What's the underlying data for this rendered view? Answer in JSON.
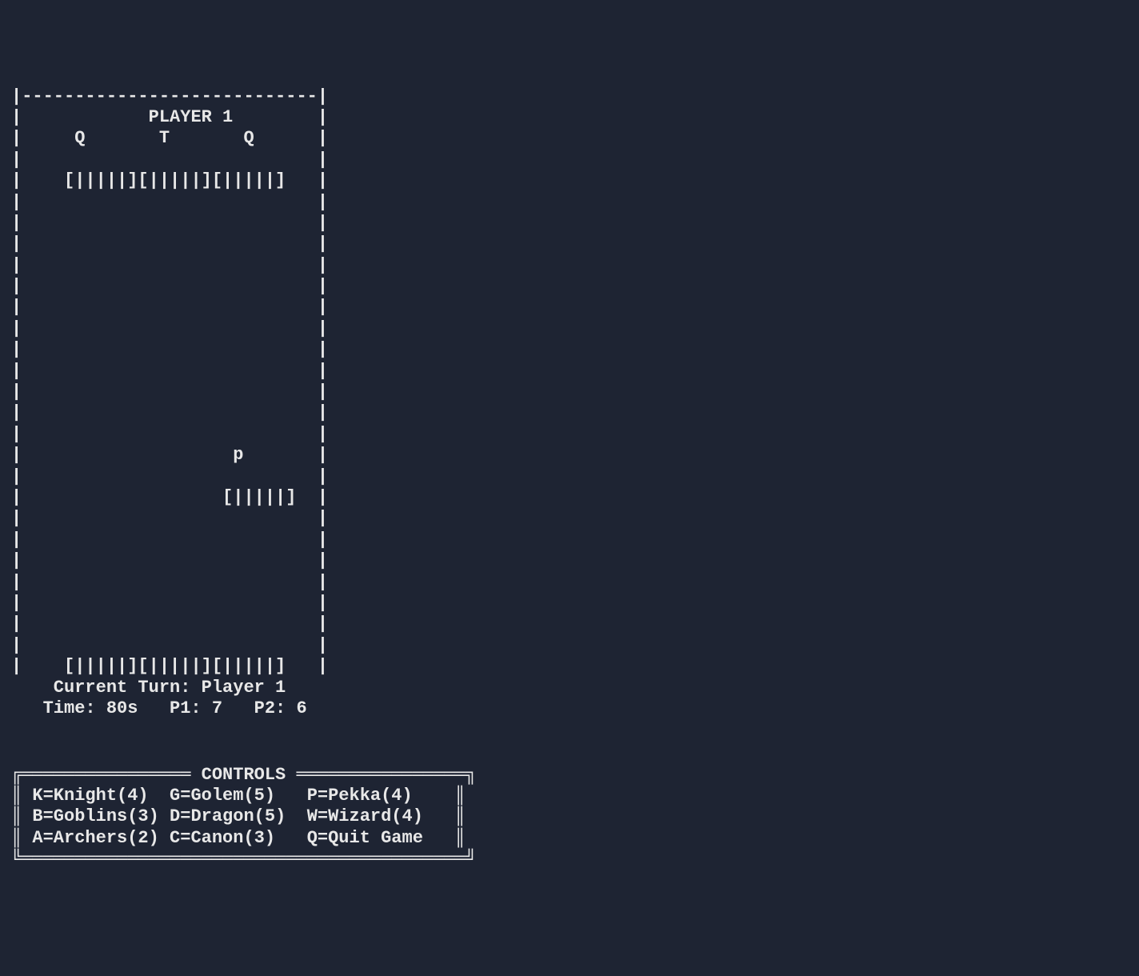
{
  "arena": {
    "top_border": "|----------------------------|",
    "player_label": "            PLAYER 1",
    "towers_row": "     Q       T       Q",
    "empty_row": "",
    "health_bars_top": "    [|||||][|||||][|||||]",
    "unit_p_row": "                    p",
    "health_bar_mid": "                   [|||||]",
    "health_bars_bottom": "    [|||||][|||||][|||||]",
    "side_left": "|",
    "side_right": "|"
  },
  "status": {
    "turn_line": "    Current Turn: Player 1",
    "score_line": "   Time: 80s   P1: 7   P2: 6",
    "turn_label": "Current Turn:",
    "turn_value": "Player 1",
    "time_label": "Time:",
    "time_value": "80s",
    "p1_label": "P1:",
    "p1_value": "7",
    "p2_label": "P2:",
    "p2_value": "6"
  },
  "controls": {
    "title": "CONTROLS",
    "rows": [
      {
        "c1": "K=Knight(4)",
        "c2": "G=Golem(5)",
        "c3": "P=Pekka(4)"
      },
      {
        "c1": "B=Goblins(3)",
        "c2": "D=Dragon(5)",
        "c3": "W=Wizard(4)"
      },
      {
        "c1": "A=Archers(2)",
        "c2": "C=Canon(3)",
        "c3": "Q=Quit Game"
      }
    ],
    "box": {
      "top_left": "╔",
      "top_right": "╗",
      "bottom_left": "╚",
      "bottom_right": "╝",
      "horizontal": "═",
      "vertical": "║"
    }
  }
}
